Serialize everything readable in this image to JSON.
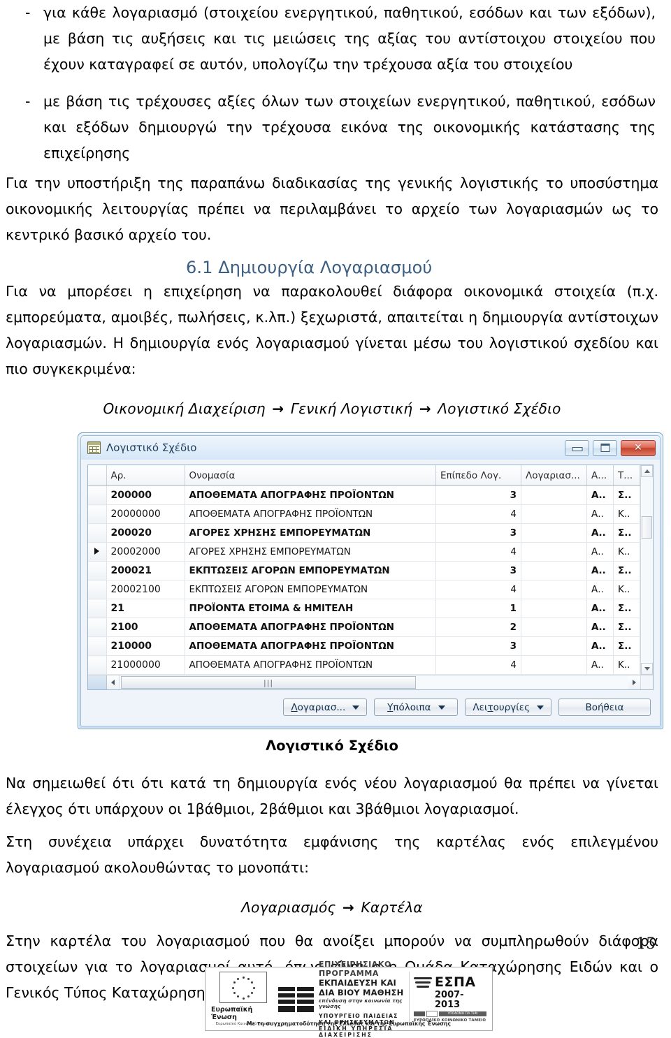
{
  "body": {
    "bullets": [
      {
        "marker": "-",
        "text": "για κάθε λογαριασμό (στοιχείου ενεργητικού, παθητικού, εσόδων και των εξόδων), με βάση τις αυξήσεις και τις μειώσεις της αξίας του αντίστοιχου στοιχείου που έχουν καταγραφεί σε αυτόν, υπολογίζω την τρέχουσα αξία του στοιχείου"
      },
      {
        "marker": "-",
        "text": "με βάση τις τρέχουσες αξίες όλων των στοιχείων ενεργητικού, παθητικού, εσόδων και εξόδων δημιουργώ την τρέχουσα εικόνα της οικονομικής κατάστασης της επιχείρησης"
      }
    ],
    "para_support": "Για την υποστήριξη της παραπάνω διαδικασίας της γενικής λογιστικής το υποσύστημα οικονομικής λειτουργίας πρέπει να περιλαμβάνει το αρχείο των λογαριασμών ως το κεντρικό βασικό αρχείο του.",
    "section_heading": "6.1 Δημιουργία Λογαριασμού",
    "para_intro": "Για να μπορέσει η επιχείρηση να παρακολουθεί διάφορα οικονομικά στοιχεία (π.χ. εμπορεύματα, αμοιβές, πωλήσεις, κ.λπ.) ξεχωριστά, απαιτείται η δημιουργία αντίστοιχων λογαριασμών. Η δημιουργία ενός λογαριασμού γίνεται μέσω του λογιστικού σχεδίου και πιο συγκεκριμένα:",
    "path1": {
      "part1": "Οικονομική Διαχείριση",
      "arrow1": "→",
      "part2": "Γενική Λογιστική",
      "arrow2": "→",
      "part3": "Λογιστικό Σχέδιο"
    },
    "figure_caption": "Λογιστικό Σχέδιο",
    "para_note": "Να σημειωθεί ότι ότι κατά τη δημιουργία ενός νέου λογαριασμού θα πρέπει να γίνεται έλεγχος ότι υπάρχουν οι 1βάθμιοι, 2βάθμιοι και 3βάθμιοι λογαριασμοί.",
    "para_card": "Στη συνέχεια υπάρχει δυνατότητα εμφάνισης της καρτέλας ενός επιλεγμένου λογαριασμού ακολουθώντας το μονοπάτι:",
    "path2": {
      "part1": "Λογαριασμός",
      "arrow1": "→",
      "part2": "Καρτέλα"
    },
    "para_final": "Στην καρτέλα του λογαριασμού που θα ανοίξει μπορούν να συμπληρωθούν διάφορα στοιχείων για το λογαριασμοί αυτό, όπως είναι ο η Ομάδα Καταχώρησης Ειδών και ο Γενικός Τύπος Καταχώρησης.",
    "page_number": "15"
  },
  "window": {
    "title": "Λογιστικό Σχέδιο",
    "icon": "grid-table-icon",
    "controls": {
      "minimize": "minimize-icon",
      "maximize": "maximize-icon",
      "close": "✕"
    },
    "grid": {
      "headers": {
        "selector": "",
        "number": "Αρ.",
        "name": "Ονομασία",
        "level": "Επίπεδο Λογ.",
        "account": "Λογαριασ...",
        "a": "Α...",
        "t": "Τ..."
      },
      "rows": [
        {
          "selected": false,
          "bold": true,
          "number": "200000",
          "name": "ΑΠΟΘΕΜΑΤΑ ΑΠΟΓΡΑΦΗΣ ΠΡΟΪΟΝΤΩΝ",
          "level": "3",
          "account": "",
          "a": "Α..",
          "t": "Σ.."
        },
        {
          "selected": false,
          "bold": false,
          "number": "20000000",
          "name": "ΑΠΟΘΕΜΑΤΑ ΑΠΟΓΡΑΦΗΣ ΠΡΟΪΟΝΤΩΝ",
          "level": "4",
          "account": "",
          "a": "Α..",
          "t": "Κ.."
        },
        {
          "selected": false,
          "bold": true,
          "number": "200020",
          "name": "ΑΓΟΡΕΣ ΧΡΗΣΗΣ ΕΜΠΟΡΕΥΜΑΤΩΝ",
          "level": "3",
          "account": "",
          "a": "Α..",
          "t": "Σ.."
        },
        {
          "selected": true,
          "bold": false,
          "number": "20002000",
          "name": "ΑΓΟΡΕΣ ΧΡΗΣΗΣ ΕΜΠΟΡΕΥΜΑΤΩΝ",
          "level": "4",
          "account": "",
          "a": "Α..",
          "t": "Κ.."
        },
        {
          "selected": false,
          "bold": true,
          "number": "200021",
          "name": "ΕΚΠΤΩΣΕΙΣ ΑΓΟΡΩΝ ΕΜΠΟΡΕΥΜΑΤΩΝ",
          "level": "3",
          "account": "",
          "a": "Α..",
          "t": "Σ.."
        },
        {
          "selected": false,
          "bold": false,
          "number": "20002100",
          "name": "ΕΚΠΤΩΣΕΙΣ ΑΓΟΡΩΝ ΕΜΠΟΡΕΥΜΑΤΩΝ",
          "level": "4",
          "account": "",
          "a": "Α..",
          "t": "Κ.."
        },
        {
          "selected": false,
          "bold": true,
          "number": "21",
          "name": "ΠΡΟΪΟΝΤΑ ΕΤΟΙΜΑ & ΗΜΙΤΕΛΗ",
          "level": "1",
          "account": "",
          "a": "Α..",
          "t": "Σ.."
        },
        {
          "selected": false,
          "bold": true,
          "number": "2100",
          "name": "ΑΠΟΘΕΜΑΤΑ ΑΠΟΓΡΑΦΗΣ ΠΡΟΪΟΝΤΩΝ",
          "level": "2",
          "account": "",
          "a": "Α..",
          "t": "Σ.."
        },
        {
          "selected": false,
          "bold": true,
          "number": "210000",
          "name": "ΑΠΟΘΕΜΑΤΑ ΑΠΟΓΡΑΦΗΣ ΠΡΟΪΟΝΤΩΝ",
          "level": "3",
          "account": "",
          "a": "Α..",
          "t": "Σ.."
        },
        {
          "selected": false,
          "bold": false,
          "number": "21000000",
          "name": "ΑΠΟΘΕΜΑΤΑ ΑΠΟΓΡΑΦΗΣ ΠΡΟΪΟΝΤΩΝ",
          "level": "4",
          "account": "",
          "a": "Α..",
          "t": "Κ.."
        }
      ],
      "hscroll_grip": "|||"
    },
    "buttons": [
      {
        "label": "Λογαριασ...",
        "accesskey": "Λ",
        "dropdown": true
      },
      {
        "label": "Υπόλοιπα",
        "accesskey": "Υ",
        "dropdown": true
      },
      {
        "label": "Λειτουργίες",
        "accesskey": "τ",
        "dropdown": true
      },
      {
        "label": "Βοήθεια",
        "accesskey": "",
        "dropdown": false
      }
    ]
  },
  "footer_logo": {
    "eu_name": "Ευρωπαϊκή Ένωση",
    "eu_sub": "Ευρωπαϊκό Κοινωνικό Ταμείο",
    "line1": "ΕΠΙΧΕΙΡΗΣΙΑΚΟ ΠΡΟΓΡΑΜΜΑ",
    "line2": "ΕΚΠΑΙΔΕΥΣΗ ΚΑΙ ΔΙΑ ΒΙΟΥ ΜΑΘΗΣΗ",
    "line3": "επένδυση στην κοινωνία της γνώσης",
    "line4": "ΥΠΟΥΡΓΕΙΟ ΠΑΙΔΕΙΑΣ ΚΑΙ ΘΡΗΣΚΕΥΜΑΤΩΝ",
    "line5": "ΕΙΔΙΚΗ ΥΠΗΡΕΣΙΑ ΔΙΑΧΕΙΡΙΣΗΣ",
    "espa_word": "ΕΣΠΑ",
    "espa_years": "2007-2013",
    "espa_chip_text": "ΥΠΟΔΟΜΗ ΓΙΑ ΤΗΝ ΑΝΑΠΤΥΞΗ",
    "espa_foot": "ΕΥΡΩΠΑΪΚΟ ΚΟΙΝΩΝΙΚΟ ΤΑΜΕΙΟ",
    "caption": "Με τη συγχρηματοδότηση της Ελλάδας και της Ευρωπαϊκής Ένωσης"
  },
  "colors": {
    "heading_blue": "#3b5e82",
    "window_border": "#6f9fc8",
    "close_red": "#c2412c"
  }
}
